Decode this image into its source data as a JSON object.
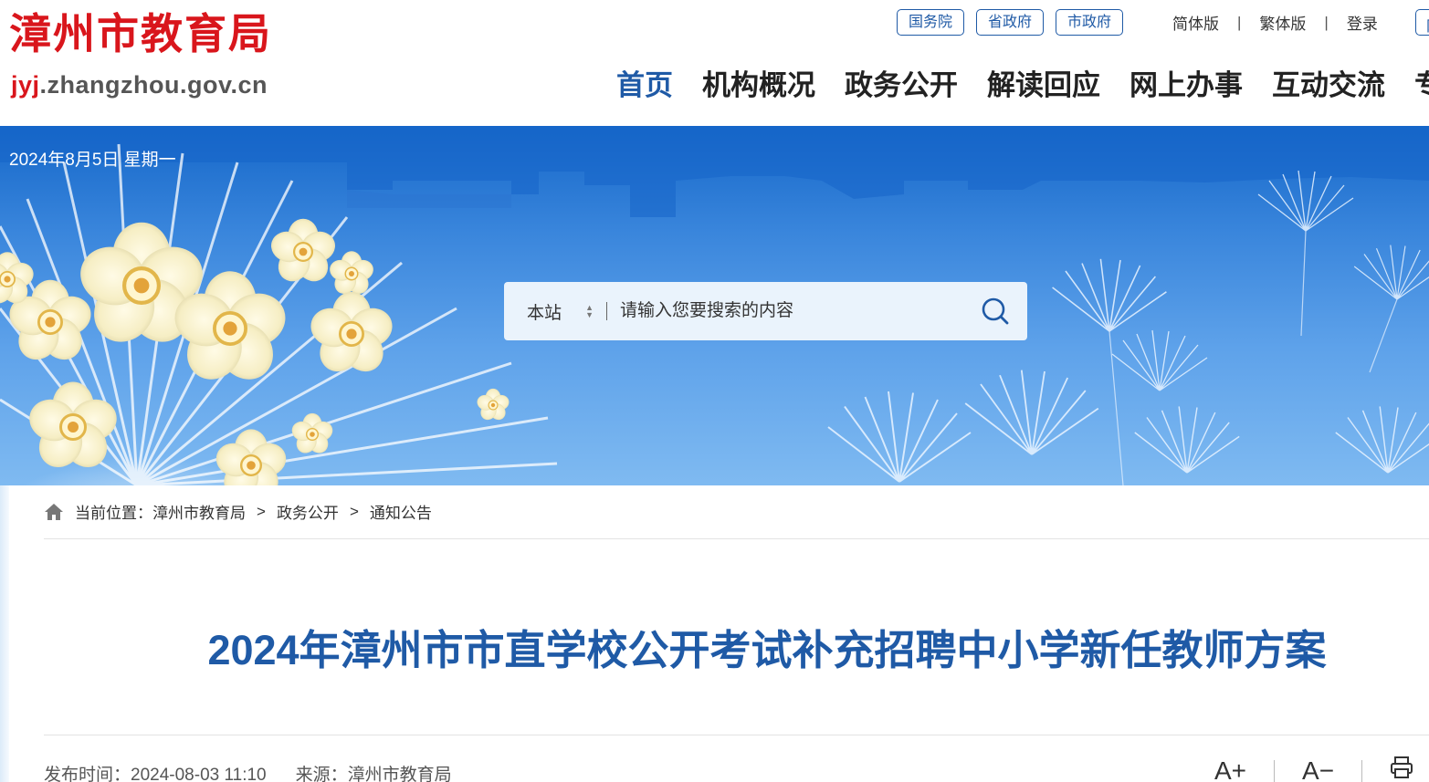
{
  "site": {
    "title": "漳州市教育局",
    "domain_highlight": "jyj",
    "domain_rest": ".zhangzhou.gov.cn",
    "brand_color": "#d9161c",
    "accent_color": "#1f5aa6"
  },
  "gov_links": [
    {
      "label": "国务院"
    },
    {
      "label": "省政府"
    },
    {
      "label": "市政府"
    }
  ],
  "util_links": {
    "simplified": "简体版",
    "sep": "|",
    "traditional": "繁体版",
    "login": "登录"
  },
  "nav": [
    {
      "label": "首页",
      "active": true
    },
    {
      "label": "机构概况"
    },
    {
      "label": "政务公开"
    },
    {
      "label": "解读回应"
    },
    {
      "label": "网上办事"
    },
    {
      "label": "互动交流"
    },
    {
      "label": "专"
    }
  ],
  "banner": {
    "date": "2024年8月5日 星期一"
  },
  "search": {
    "scope": "本站",
    "placeholder": "请输入您要搜索的内容",
    "icon": "search-icon"
  },
  "breadcrumb": {
    "prefix": "当前位置：",
    "items": [
      "漳州市教育局",
      "政务公开",
      "通知公告"
    ],
    "separator": ">",
    "icon": "home-icon"
  },
  "article": {
    "title": "2024年漳州市市直学校公开考试补充招聘中小学新任教师方案",
    "publish_label": "发布时间：",
    "publish_time": "2024-08-03 11:10",
    "source_label": "来源：",
    "source": "漳州市教育局"
  },
  "tools": {
    "font_increase": "A+",
    "font_decrease": "A−",
    "print_icon": "print-icon"
  }
}
